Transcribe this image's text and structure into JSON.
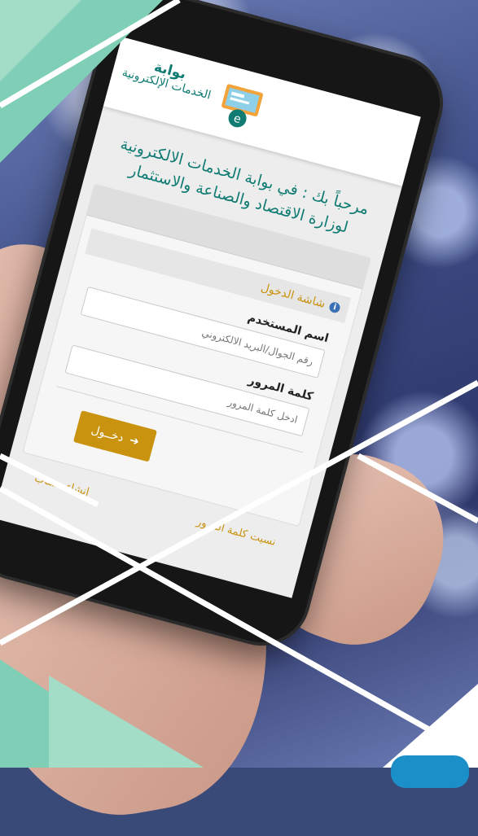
{
  "portal": {
    "name_line1": "بوابة",
    "name_line2": "الخدمات الإلكترونية"
  },
  "welcome": {
    "text": "مرحباً بك : في بوابة الخدمات الالكترونية لوزارة الاقتصاد والصناعة والاستثمار"
  },
  "login": {
    "header": "شاشة الدخول",
    "username_label": "اسم المستخدم",
    "username_placeholder": "رقم الجوال/البريد الالكتروني",
    "password_label": "كلمة المرور",
    "password_placeholder": "ادخل كلمة المرور",
    "submit_label": "دخــول",
    "create_account": "إنشاء حساب",
    "forgot_password": "نسيت كلمة المرور"
  },
  "colors": {
    "teal": "#0f7b72",
    "gold": "#c9930f",
    "mint": "#7fcfb7"
  }
}
